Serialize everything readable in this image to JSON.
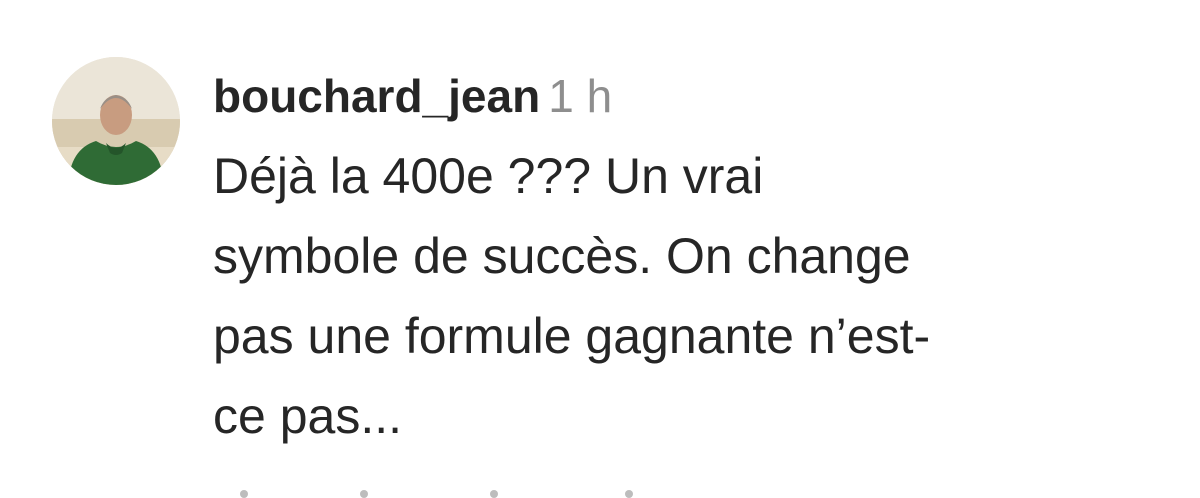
{
  "comment": {
    "username": "bouchard_jean",
    "timestamp": "1 h",
    "text_lines": [
      "Déjà la 400e ??? Un vrai",
      "symbole de succès. On change",
      "pas une formule gagnante n’est-",
      "ce pas..."
    ],
    "avatar_icon": "user-avatar-photo"
  },
  "colors": {
    "text": "#262626",
    "muted": "#8e8e8e",
    "background": "#ffffff"
  }
}
